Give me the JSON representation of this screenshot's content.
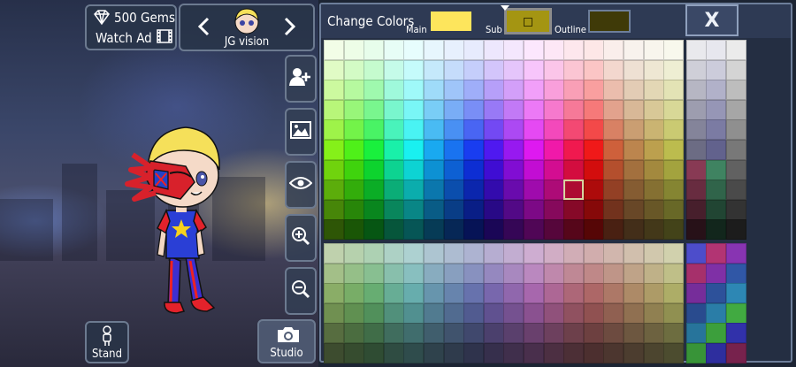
{
  "top": {
    "gems_label": "500 Gems",
    "watch_ad_label": "Watch Ad",
    "character_name": "JG vision"
  },
  "bottom": {
    "stand_label": "Stand",
    "studio_label": "Studio"
  },
  "color_panel": {
    "title": "Change Colors",
    "main_label": "Main",
    "sub_label": "Sub",
    "outline_label": "Outline",
    "close_label": "X",
    "main_color": "#fde55c",
    "sub_color": "#a49512",
    "outline_color": "#3f3a08"
  },
  "icons": [
    "gem-icon",
    "film-icon",
    "prev-arrow-icon",
    "next-arrow-icon",
    "add-person-icon",
    "image-icon",
    "eye-icon",
    "zoom-in-icon",
    "zoom-out-icon",
    "person-icon",
    "camera-icon",
    "close-icon"
  ]
}
